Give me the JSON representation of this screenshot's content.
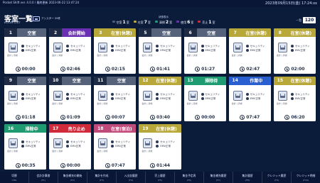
{
  "topbar": {
    "left": "Pocket Shift ver. 4.0.0 / 最終更新 2023-06-22 13:47:24",
    "right": "2023年09月15日(金) 17:24:xx"
  },
  "header": {
    "title": "客室一覧",
    "subtitle": "ROOM LIST",
    "badge_text": "アシスター 29件",
    "legend_title": "状態表示",
    "legend": [
      {
        "label": "空室",
        "count": "1",
        "unit": "室",
        "color": "#4b5a80"
      },
      {
        "label": "在室",
        "count": "7",
        "unit": "室",
        "color": "#b8a739"
      },
      {
        "label": "清掃",
        "count": "2",
        "unit": "室",
        "color": "#1f9b72"
      },
      {
        "label": "使用",
        "count": "6",
        "unit": "室",
        "color": "#6a2fb3"
      },
      {
        "label": "売止",
        "count": "1",
        "unit": "室",
        "color": "#d12a3b"
      }
    ],
    "right_label": "一覧",
    "right_value": "120"
  },
  "rooms": [
    {
      "num": "1",
      "status": "空室",
      "num_color": "#1f2a44",
      "status_color": "#56617a",
      "checks": [
        "セキュリティ",
        "EMV正常"
      ],
      "small": "会計 | 清掃",
      "timer": "00:00"
    },
    {
      "num": "2",
      "status": "会計開始",
      "num_color": "#1f2a44",
      "status_color": "#6a2fb3",
      "checks": [
        "セキュリティ",
        "EMV正常"
      ],
      "small": "会計 | 清掃",
      "timer": "02:46"
    },
    {
      "num": "3",
      "status": "在室(休憩)",
      "num_color": "#b8a739",
      "status_color": "#b8a739",
      "checks": [
        "セキュリティ",
        "EMV正常"
      ],
      "small": "会計 | 清掃",
      "timer": "02:15"
    },
    {
      "num": "5",
      "status": "空室",
      "num_color": "#1f2a44",
      "status_color": "#56617a",
      "checks": [
        "セキュリティ",
        "EMV正常"
      ],
      "small": "会計 | 清掃",
      "timer": "01:41"
    },
    {
      "num": "6",
      "status": "空室",
      "num_color": "#1f2a44",
      "status_color": "#56617a",
      "checks": [
        "セキュリティ",
        "EMV正常"
      ],
      "small": "会計 | 清掃",
      "timer": "01:27"
    },
    {
      "num": "7",
      "status": "在室(休憩)",
      "num_color": "#b8a739",
      "status_color": "#b8a739",
      "checks": [
        "セキュリティ",
        "EMV正常"
      ],
      "small": "会計 | 清掃",
      "timer": "02:47"
    },
    {
      "num": "8",
      "status": "在室(休憩)",
      "num_color": "#b8a739",
      "status_color": "#b8a739",
      "checks": [
        "セキュリティ",
        "EMV正常"
      ],
      "small": "会計 | 清掃",
      "timer": "02:00"
    },
    {
      "num": "9",
      "status": "空室",
      "num_color": "#1f2a44",
      "status_color": "#56617a",
      "checks": [
        "セキュリティ",
        "EMV正常"
      ],
      "small": "会計 | 清掃",
      "timer": "01:18"
    },
    {
      "num": "10",
      "status": "空室",
      "num_color": "#1f2a44",
      "status_color": "#56617a",
      "checks": [
        "セキュリティ",
        "EMV正常"
      ],
      "small": "会計 | 清掃",
      "timer": "01:09"
    },
    {
      "num": "11",
      "status": "空室",
      "num_color": "#1f2a44",
      "status_color": "#56617a",
      "checks": [
        "セキュリティ",
        "EMV正常"
      ],
      "small": "会計 | 清掃",
      "timer": "00:07"
    },
    {
      "num": "12",
      "status": "在室(休憩)",
      "num_color": "#b8a739",
      "status_color": "#b8a739",
      "checks": [
        "セキュリティ",
        "EMV正常"
      ],
      "small": "会計 | 清掃",
      "timer": "03:40"
    },
    {
      "num": "13",
      "status": "掃除待",
      "num_color": "#1f9b72",
      "status_color": "#1f9b72",
      "checks": [
        "セキュリティ",
        "EMV正常"
      ],
      "small": "会計 | 清掃",
      "timer": "00:00"
    },
    {
      "num": "14",
      "status": "作業中",
      "num_color": "#2a5fd1",
      "status_color": "#2a5fd1",
      "checks": [
        "セキュリティ",
        "EMV正常"
      ],
      "small": "会計 | 清掃",
      "timer": "07:47"
    },
    {
      "num": "15",
      "status": "在室(休憩)",
      "num_color": "#b8a739",
      "status_color": "#b8a739",
      "checks": [
        "セキュリティ",
        "EMV正常"
      ],
      "small": "会計 | 清掃",
      "timer": "06:20"
    },
    {
      "num": "16",
      "status": "掃除中",
      "num_color": "#1f9b72",
      "status_color": "#1f9b72",
      "checks": [
        "セキュリティ",
        "EMV正常"
      ],
      "small": "会計 | 清掃",
      "timer": "00:35"
    },
    {
      "num": "17",
      "status": "売り止め",
      "num_color": "#d12a3b",
      "status_color": "#d12a3b",
      "checks": [
        "セキュリティ",
        "EMV正常"
      ],
      "small": "会計 | 清掃",
      "timer": "00:00"
    },
    {
      "num": "18",
      "status": "在室(宿泊)",
      "num_color": "#c04a7a",
      "status_color": "#c04a7a",
      "checks": [
        "セキュリティ",
        "EMV正常"
      ],
      "small": "会計 | 清掃",
      "timer": "07:47"
    },
    {
      "num": "19",
      "status": "在室(休憩)",
      "num_color": "#b8a739",
      "status_color": "#b8a739",
      "checks": [
        "セキュリティ",
        "EMV正常"
      ],
      "small": "会計 | 清掃",
      "timer": "01:44"
    }
  ],
  "bottom_bar": [
    {
      "label": "切替",
      "sub": "CHG"
    },
    {
      "label": "会計計算書",
      "sub": "(F1)"
    },
    {
      "label": "集金補充の開始",
      "sub": "(F2)"
    },
    {
      "label": "集計を作成",
      "sub": "(F3)"
    },
    {
      "label": "入出金履歴",
      "sub": "(F4)"
    },
    {
      "label": "売上履歴",
      "sub": "(F5)"
    },
    {
      "label": "集金予定表",
      "sub": "(F6)"
    },
    {
      "label": "集金補充履歴",
      "sub": "(F7)"
    },
    {
      "label": "集計履歴",
      "sub": "(F8)"
    },
    {
      "label": "クレジット履歴",
      "sub": "(F9)"
    },
    {
      "label": "クレジット明細",
      "sub": "(F10)"
    }
  ]
}
